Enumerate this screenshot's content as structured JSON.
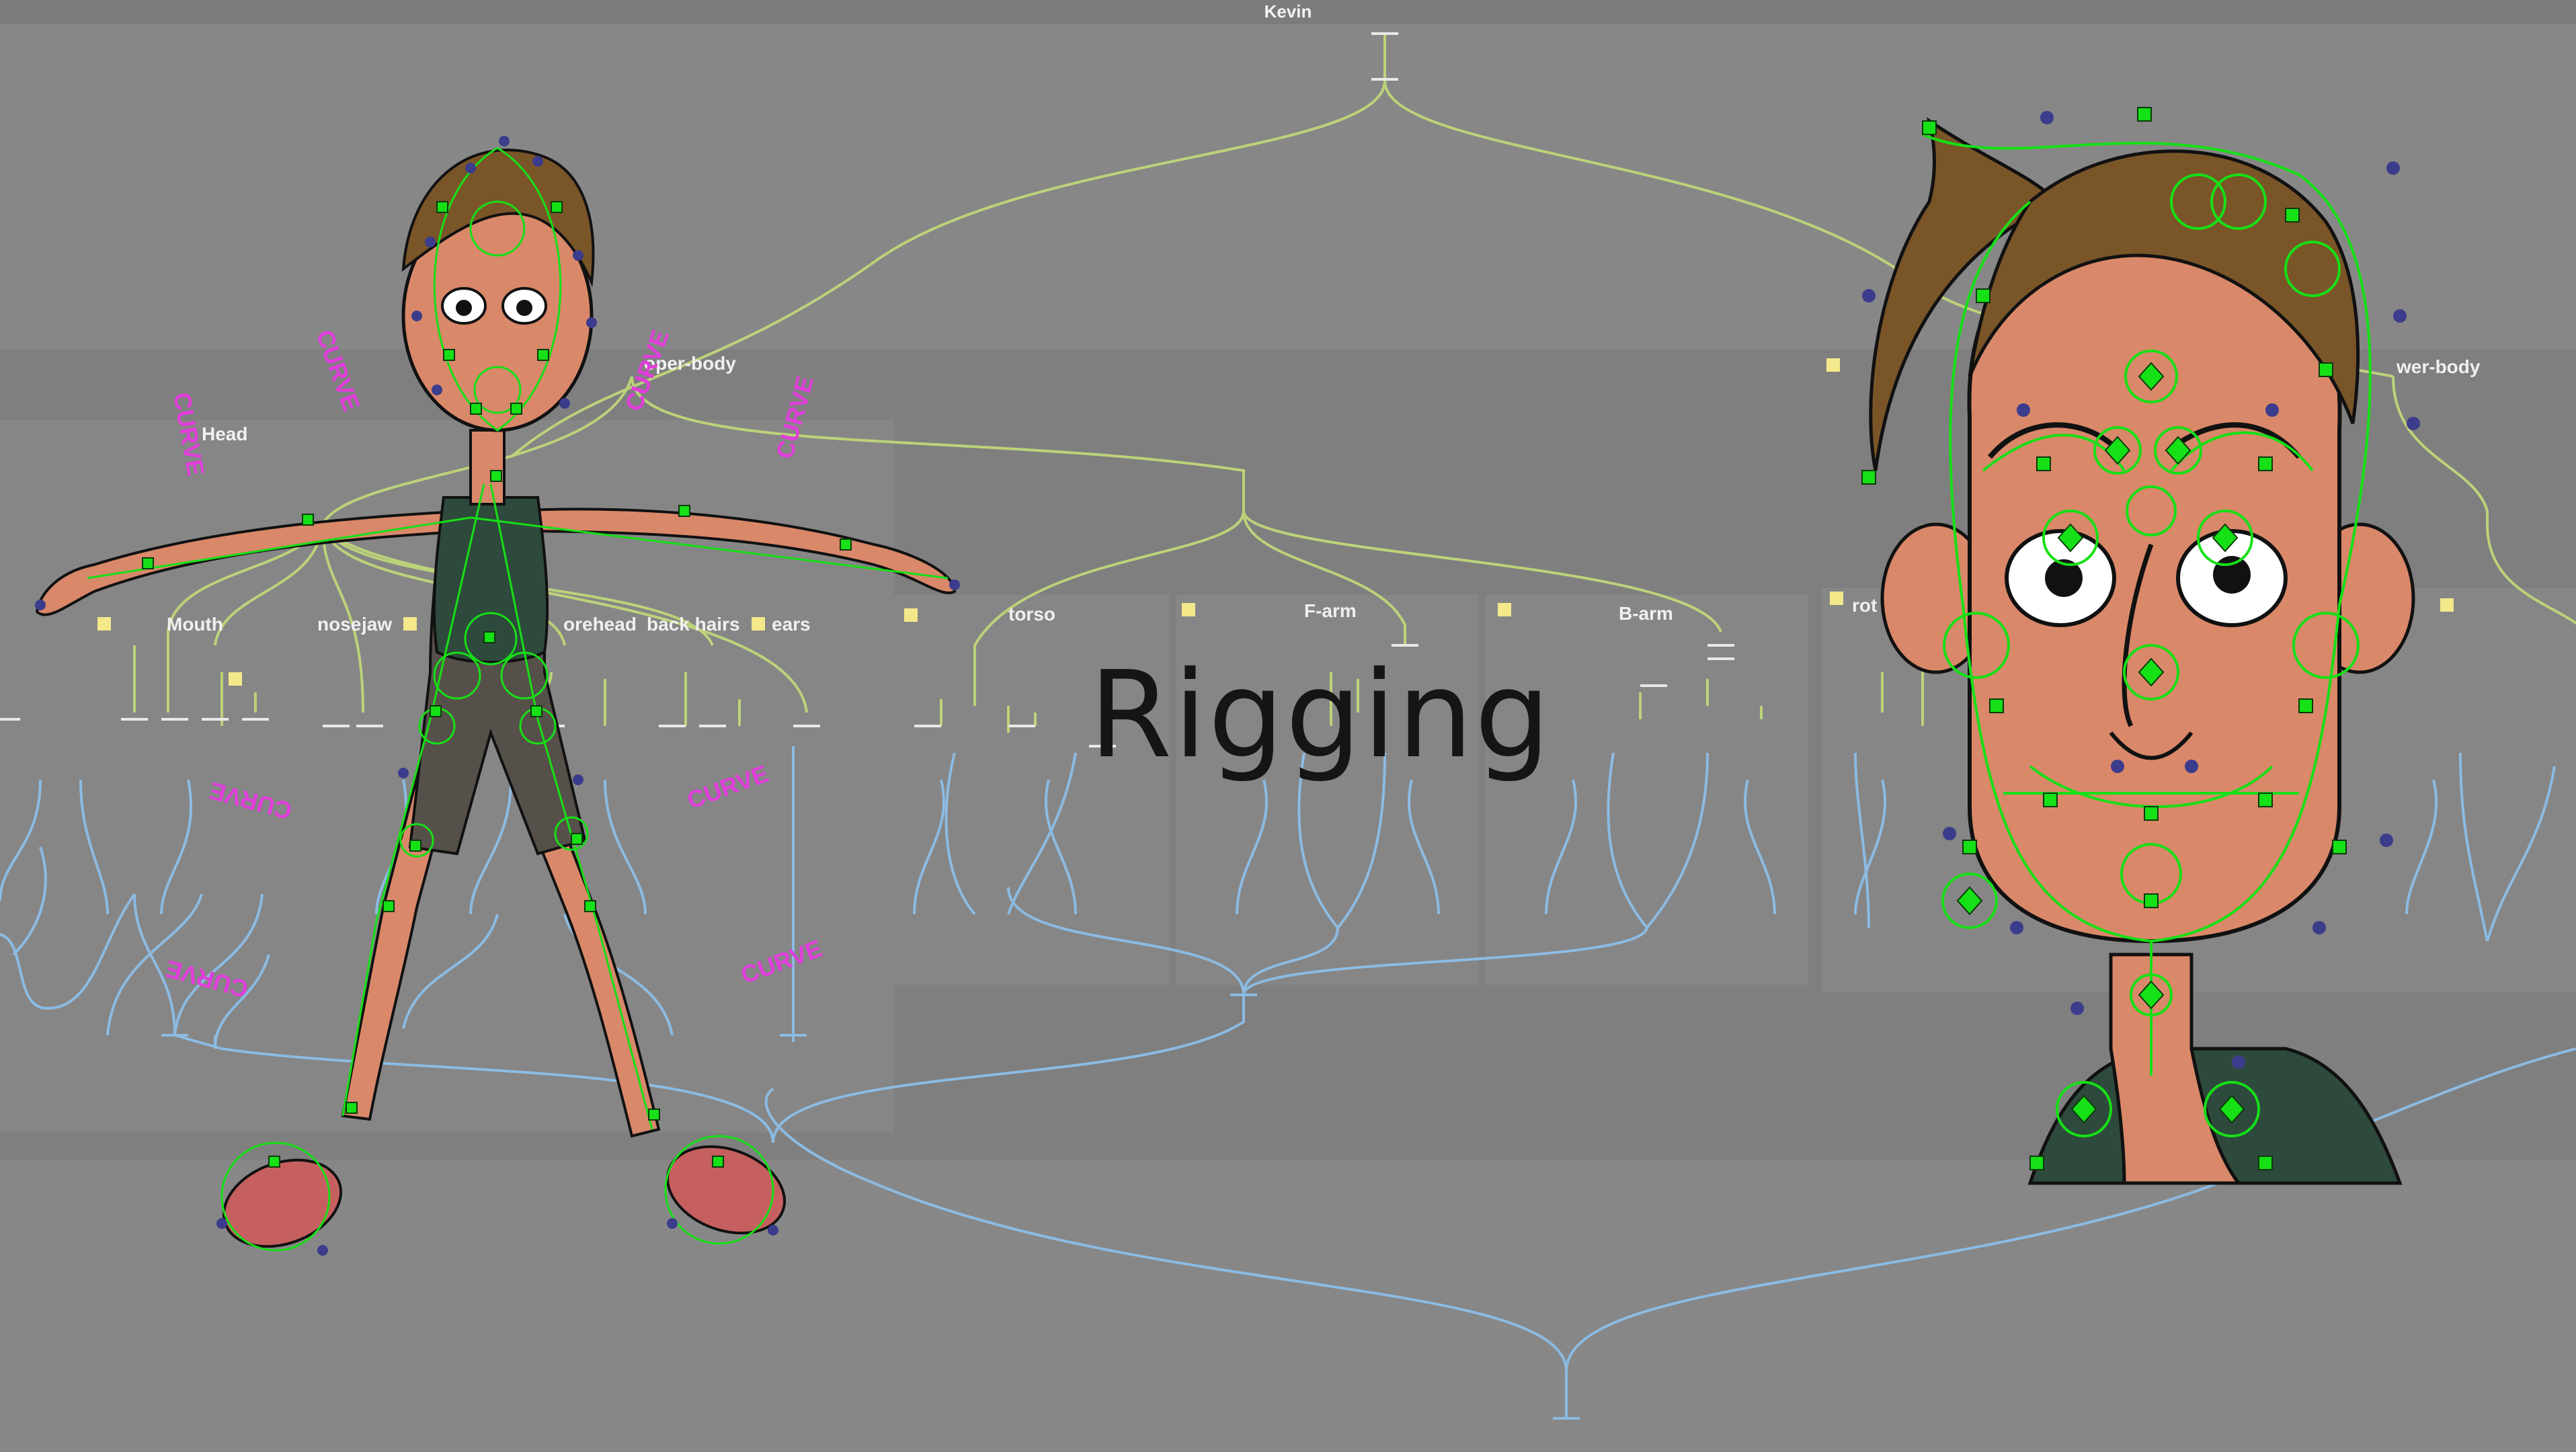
{
  "window": {
    "title": "Kevin"
  },
  "overlay": {
    "headline": "Rigging"
  },
  "groups": {
    "upper_body": "oper-body",
    "lower_body": "wer-body",
    "head": "Head",
    "mouth": "Mouth",
    "nose": "nose",
    "jaw": "jaw",
    "forehead": "orehead",
    "back_hairs": "back hairs",
    "ears": "ears",
    "torso": "torso",
    "f_arm": "F-arm",
    "b_arm": "B-arm",
    "rot": "rot"
  },
  "curve_label": "CURVE",
  "colors": {
    "background": "#878787",
    "panel": "#7f7f7f",
    "wire_upper": "#bcd27a",
    "wire_lower": "#8cbbe2",
    "control_green": "#16e016",
    "control_blue": "#3c3c8c",
    "skin": "#d9886a",
    "hair": "#7a5528",
    "shirt": "#2e4a3c",
    "shoe": "#c66060",
    "curve_tag": "#e23ddc",
    "swatch": "#f3e88a"
  },
  "icons": [
    "group-swatch-icon",
    "control-point-icon",
    "pivot-icon"
  ]
}
